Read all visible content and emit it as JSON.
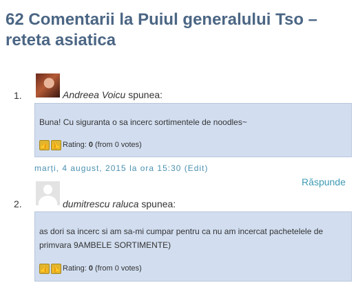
{
  "heading": "62 Comentarii la Puiul generalului Tso – reteta asiatica",
  "comments": [
    {
      "number": "1.",
      "author": "Andreea Voicu",
      "says": "spunea:",
      "text": "Buna! Cu siguranta o sa incerc sortimentele de noodles~",
      "rating_label": "Rating:",
      "rating_value": "0",
      "rating_votes": "(from 0 votes)",
      "date": "marți, 4 august, 2015 la ora 15:30",
      "edit_label": "(Edit)",
      "reply_label": "Răspunde"
    },
    {
      "number": "2.",
      "author": "dumitrescu raluca",
      "says": "spunea:",
      "text": "as dori sa incerc si am sa-mi cumpar pentru ca nu am incercat pachetelele de primvara 9AMBELE SORTIMENTE)",
      "rating_label": "Rating:",
      "rating_value": "0",
      "rating_votes": "(from 0 votes)"
    }
  ],
  "icons": {
    "thumb_up": "👍",
    "thumb_down": "👎"
  },
  "colors": {
    "heading": "#4b6684",
    "bubble": "#d2def0",
    "link": "#3e9ab3"
  }
}
